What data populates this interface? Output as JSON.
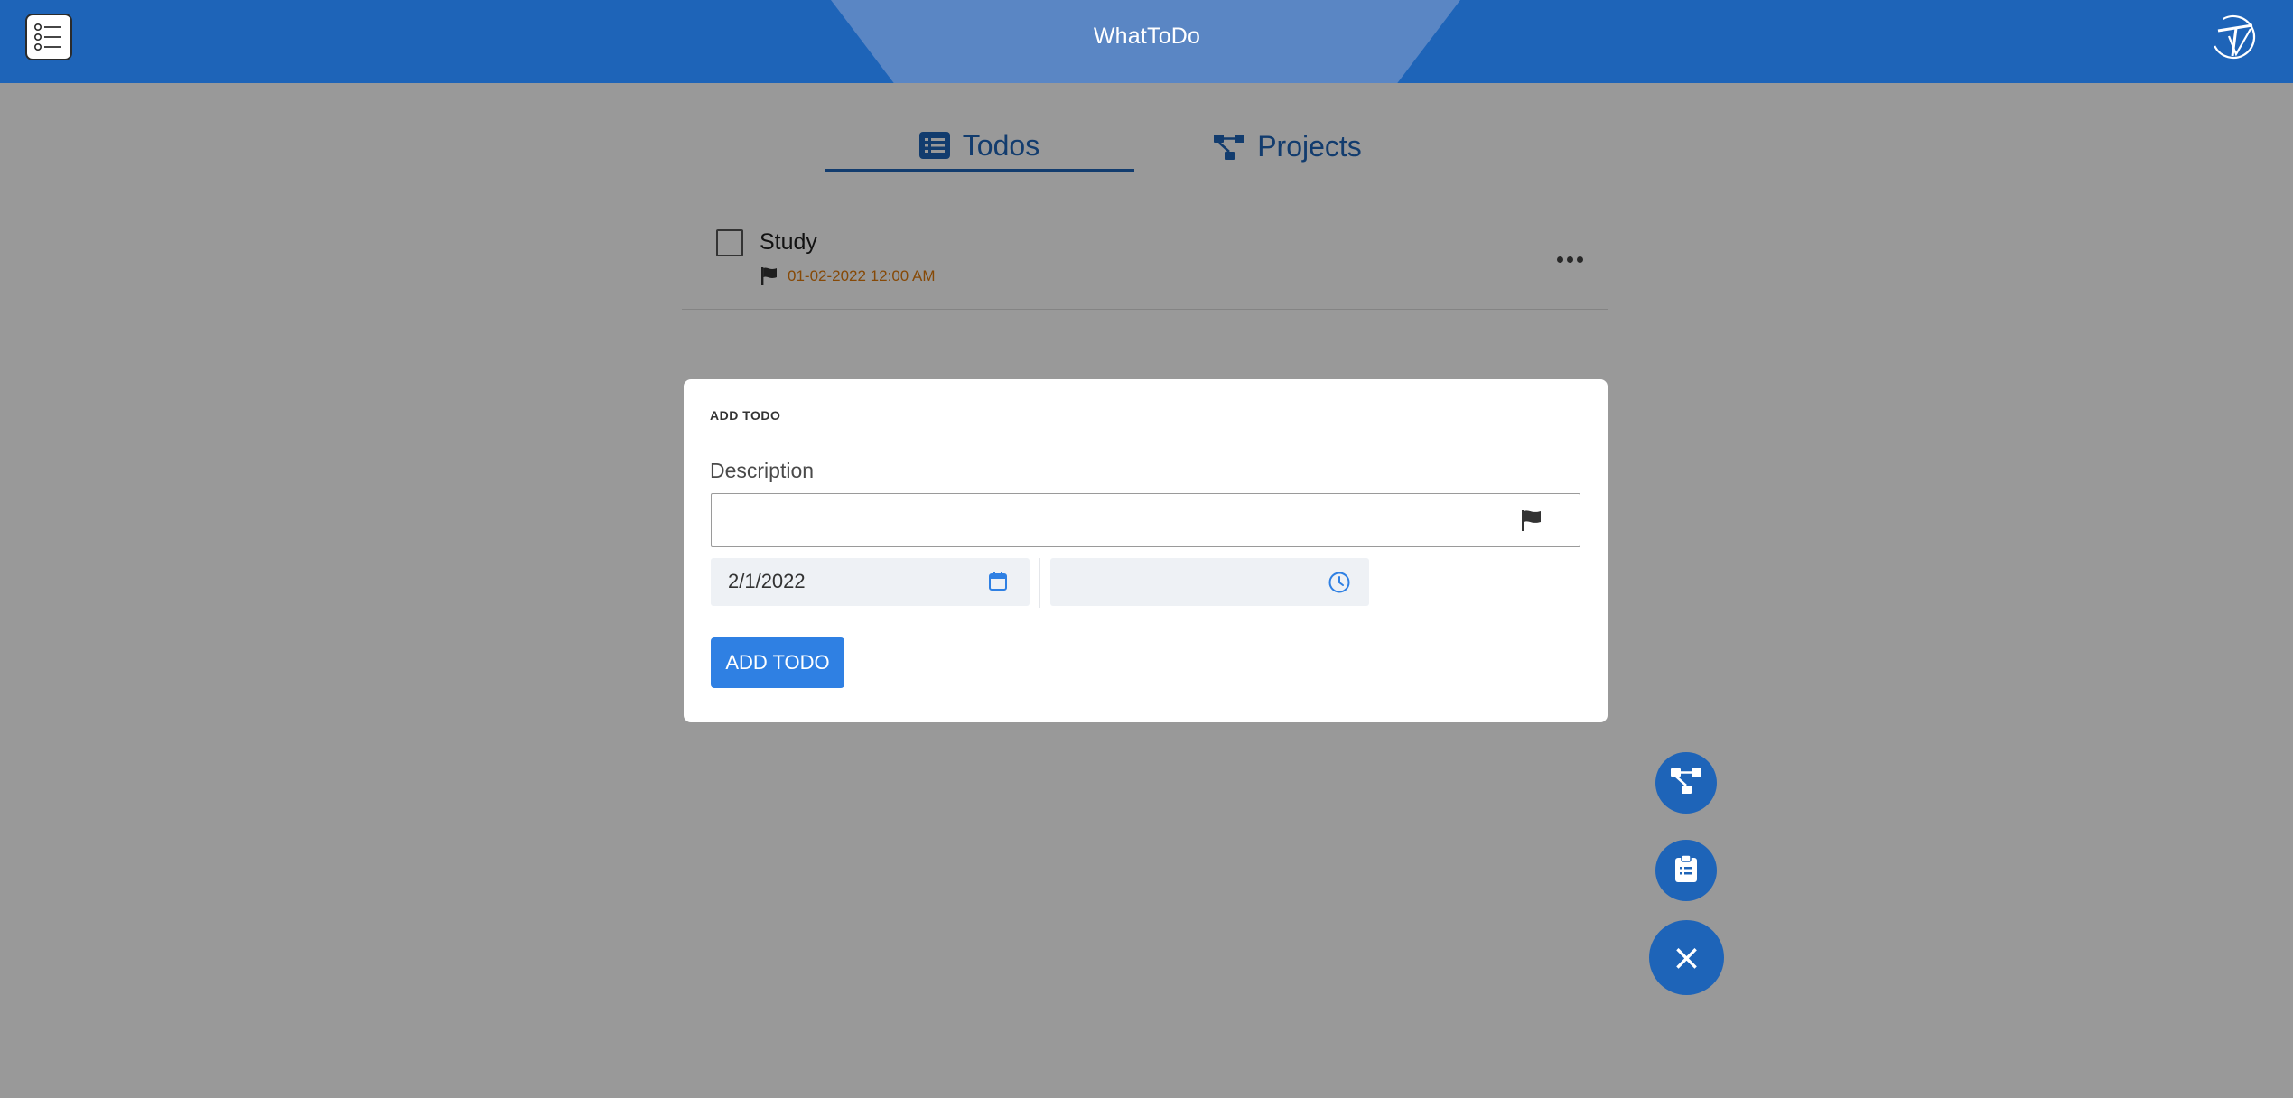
{
  "header": {
    "title": "WhatToDo",
    "menu_icon": "checklist-menu-icon",
    "logo_icon": "whattodo-logo-icon"
  },
  "tabs": [
    {
      "label": "Todos",
      "icon": "list-icon",
      "active": true
    },
    {
      "label": "Projects",
      "icon": "project-tree-icon",
      "active": false
    }
  ],
  "todos": [
    {
      "text": "Study",
      "date": "01-02-2022 12:00 AM",
      "checked": false
    }
  ],
  "modal": {
    "title": "ADD TODO",
    "description_label": "Description",
    "description_value": "",
    "date_value": "2/1/2022",
    "time_value": "",
    "submit_label": "ADD TODO"
  },
  "fabs": [
    {
      "icon": "project-tree-icon"
    },
    {
      "icon": "clipboard-icon"
    },
    {
      "icon": "close-icon",
      "label": "×"
    }
  ],
  "colors": {
    "primary": "#1e64b8",
    "header_accent": "#5a86c4",
    "button": "#2f80e3",
    "due_date": "#e07b0c"
  }
}
